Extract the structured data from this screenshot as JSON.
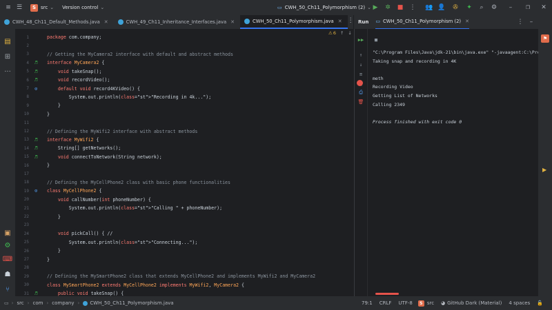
{
  "titlebar": {
    "project_initial": "S",
    "project_name": "src",
    "vcs_label": "Version control",
    "run_config": "CWH_50_Ch11_Polymorphism (2)"
  },
  "tabs": [
    {
      "label": "CWH_48_Ch11_Default_Methods.java",
      "active": false
    },
    {
      "label": "CWH_49_Ch11_Inheritance_Interfaces.java",
      "active": false
    },
    {
      "label": "CWH_50_Ch11_Polymorphism.java",
      "active": true
    }
  ],
  "editor": {
    "inspection_count": "6",
    "lines": [
      {
        "n": "1",
        "code": "package com.company;",
        "g": ""
      },
      {
        "n": "2",
        "code": "",
        "g": ""
      },
      {
        "n": "3",
        "code": "// Getting the MyCamera2 interface with default and abstract methods",
        "g": ""
      },
      {
        "n": "4",
        "code": "interface MyCamera2 {",
        "g": "impl"
      },
      {
        "n": "5",
        "code": "    void takeSnap();",
        "g": "impl"
      },
      {
        "n": "6",
        "code": "    void recordVideo();",
        "g": "impl"
      },
      {
        "n": "7",
        "code": "    default void record4KVideo() {",
        "g": "over"
      },
      {
        "n": "8",
        "code": "        System.out.println(\"Recording in 4k...\");",
        "g": ""
      },
      {
        "n": "9",
        "code": "    }",
        "g": ""
      },
      {
        "n": "10",
        "code": "}",
        "g": ""
      },
      {
        "n": "11",
        "code": "",
        "g": ""
      },
      {
        "n": "12",
        "code": "// Defining the MyWifi2 interface with abstract methods",
        "g": ""
      },
      {
        "n": "13",
        "code": "interface MyWifi2 {",
        "g": "impl"
      },
      {
        "n": "14",
        "code": "    String[] getNetworks();",
        "g": "impl"
      },
      {
        "n": "15",
        "code": "    void connectToNetwork(String network);",
        "g": "impl"
      },
      {
        "n": "16",
        "code": "}",
        "g": ""
      },
      {
        "n": "17",
        "code": "",
        "g": ""
      },
      {
        "n": "18",
        "code": "// Defining the MyCellPhone2 class with basic phone functionalities",
        "g": ""
      },
      {
        "n": "19",
        "code": "class MyCellPhone2 {",
        "g": "over"
      },
      {
        "n": "20",
        "code": "    void callNumber(int phoneNumber) {",
        "g": ""
      },
      {
        "n": "21",
        "code": "        System.out.println(\"Calling \" + phoneNumber);",
        "g": ""
      },
      {
        "n": "22",
        "code": "    }",
        "g": ""
      },
      {
        "n": "23",
        "code": "",
        "g": ""
      },
      {
        "n": "24",
        "code": "    void pickCall() { //",
        "g": ""
      },
      {
        "n": "25",
        "code": "        System.out.println(\"Connecting...\");",
        "g": ""
      },
      {
        "n": "26",
        "code": "    }",
        "g": ""
      },
      {
        "n": "27",
        "code": "}",
        "g": ""
      },
      {
        "n": "28",
        "code": "",
        "g": ""
      },
      {
        "n": "29",
        "code": "// Defining the MySmartPhone2 class that extends MyCellPhone2 and implements MyWifi2 and MyCamera2",
        "g": ""
      },
      {
        "n": "30",
        "code": "class MySmartPhone2 extends MyCellPhone2 implements MyWifi2, MyCamera2 {",
        "g": ""
      },
      {
        "n": "31",
        "code": "    public void takeSnap() {",
        "g": "impl"
      }
    ]
  },
  "run": {
    "label": "Run",
    "tab": "CWH_50_Ch11_Polymorphism (2)",
    "output": [
      "\"C:\\Program Files\\Java\\jdk-21\\bin\\java.exe\" \"-javaagent:C:\\Prog",
      "Taking snap and recording in 4K",
      "",
      "meth",
      "Recording Video",
      "Getting List of Networks",
      "Calling 2349",
      "",
      "Process finished with exit code 0"
    ]
  },
  "status": {
    "crumbs": [
      "src",
      "com",
      "company",
      "CWH_50_Ch11_Polymorphism.java"
    ],
    "position": "79:1",
    "line_sep": "CRLF",
    "encoding": "UTF-8",
    "vcs_root": "src",
    "theme": "GitHub Dark (Material)",
    "indent": "4 spaces"
  }
}
